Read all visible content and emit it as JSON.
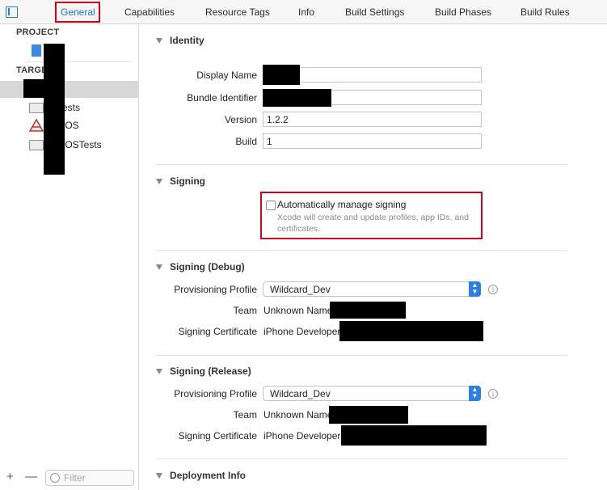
{
  "tabs": [
    {
      "label": "General",
      "active": true
    },
    {
      "label": "Capabilities"
    },
    {
      "label": "Resource Tags"
    },
    {
      "label": "Info"
    },
    {
      "label": "Build Settings"
    },
    {
      "label": "Build Phases"
    },
    {
      "label": "Build Rules"
    }
  ],
  "sidebar": {
    "project_heading": "PROJECT",
    "targets_heading": "TARGE",
    "targets": [
      {
        "label": "Tests",
        "icon": "folder-icon"
      },
      {
        "label": "tvOS",
        "icon": "app-icon"
      },
      {
        "label": "tvOSTests",
        "icon": "folder-icon"
      }
    ],
    "add": "+",
    "remove": "—",
    "filter_placeholder": "Filter"
  },
  "identity": {
    "heading": "Identity",
    "display_name_label": "Display Name",
    "bundle_id_label": "Bundle Identifier",
    "version_label": "Version",
    "version_value": "1.2.2",
    "build_label": "Build",
    "build_value": "1"
  },
  "signing": {
    "heading": "Signing",
    "auto_label": "Automatically manage signing",
    "auto_desc": "Xcode will create and update profiles, app IDs, and certificates."
  },
  "signing_debug": {
    "heading": "Signing (Debug)",
    "profile_label": "Provisioning Profile",
    "profile_value": "Wildcard_Dev",
    "team_label": "Team",
    "team_value": "Unknown Name",
    "cert_label": "Signing Certificate",
    "cert_value": "iPhone Developer:"
  },
  "signing_release": {
    "heading": "Signing (Release)",
    "profile_label": "Provisioning Profile",
    "profile_value": "Wildcard_Dev",
    "team_label": "Team",
    "team_value": "Unknown Name",
    "cert_label": "Signing Certificate",
    "cert_value": "iPhone Developer:"
  },
  "deployment": {
    "heading": "Deployment Info"
  },
  "colors": {
    "accent": "#1a73e8",
    "highlight": "#d0021b"
  }
}
